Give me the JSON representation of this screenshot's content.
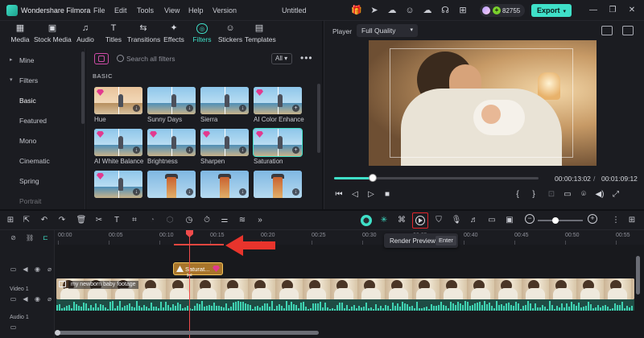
{
  "app": {
    "name": "Wondershare Filmora",
    "doc_title": "Untitled",
    "menu": [
      "File",
      "Edit",
      "Tools",
      "View",
      "Help",
      "Version"
    ],
    "credits": "82755",
    "export_label": "Export",
    "accent": "#3fe0c8"
  },
  "media_tabs": [
    {
      "label": "Media",
      "icon": "media-icon"
    },
    {
      "label": "Stock Media",
      "icon": "stock-media-icon"
    },
    {
      "label": "Audio",
      "icon": "audio-icon"
    },
    {
      "label": "Titles",
      "icon": "titles-icon"
    },
    {
      "label": "Transitions",
      "icon": "transitions-icon"
    },
    {
      "label": "Effects",
      "icon": "effects-icon"
    },
    {
      "label": "Filters",
      "icon": "filters-icon",
      "active": true
    },
    {
      "label": "Stickers",
      "icon": "stickers-icon"
    },
    {
      "label": "Templates",
      "icon": "templates-icon"
    }
  ],
  "sidebar": {
    "items": [
      {
        "label": "Mine",
        "chevron": "▸"
      },
      {
        "label": "Filters",
        "chevron": "▾"
      },
      {
        "label": "Basic",
        "active": true
      },
      {
        "label": "Featured"
      },
      {
        "label": "Mono"
      },
      {
        "label": "Cinematic"
      },
      {
        "label": "Spring"
      },
      {
        "label": "Portrait"
      }
    ]
  },
  "filters": {
    "search_placeholder": "Search all filters",
    "scope": "All",
    "section": "BASIC",
    "items": [
      {
        "name": "Hue",
        "style": "warm"
      },
      {
        "name": "Sunny Days",
        "style": "normal"
      },
      {
        "name": "Sierra",
        "style": "normal"
      },
      {
        "name": "AI Color Enhance",
        "style": "normal"
      },
      {
        "name": "AI White Balance",
        "style": "normal"
      },
      {
        "name": "Brightness",
        "style": "normal"
      },
      {
        "name": "Sharpen",
        "style": "normal"
      },
      {
        "name": "Saturation",
        "style": "normal",
        "selected": true
      },
      {
        "name": "",
        "style": "normal"
      },
      {
        "name": "",
        "style": "tower"
      },
      {
        "name": "",
        "style": "tower"
      },
      {
        "name": "",
        "style": "tower"
      }
    ]
  },
  "player": {
    "label": "Player",
    "quality": "Full Quality",
    "current_time": "00:00:13:02",
    "separator": "/",
    "total_time": "00:01:09:12",
    "progress": 0.19
  },
  "timeline": {
    "ruler": [
      "00:00",
      "00:05",
      "00:10",
      "00:15",
      "00:20",
      "00:25",
      "00:30",
      "00:35",
      "00:40",
      "00:45",
      "00:50",
      "00:55"
    ],
    "tooltip_label": "Render Preview",
    "tooltip_key": "Enter",
    "overlay_clip": "Saturat...",
    "video_clip": "my newborn baby footage",
    "video_track": "Video 1",
    "audio_track": "Audio 1",
    "zoom": 0.4
  }
}
